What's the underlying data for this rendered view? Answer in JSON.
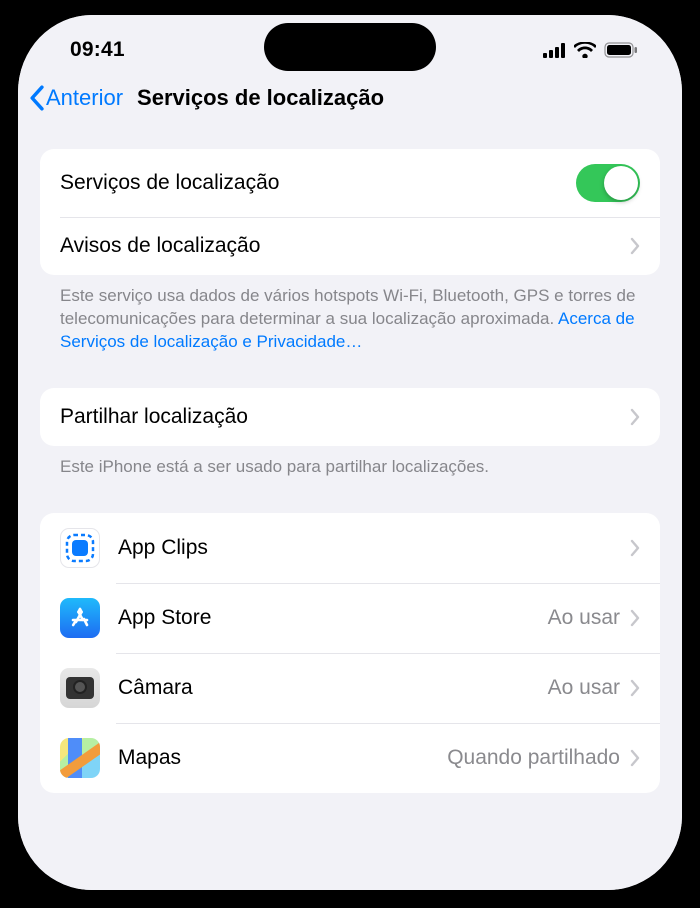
{
  "status": {
    "time": "09:41"
  },
  "nav": {
    "back_label": "Anterior",
    "title": "Serviços de localização"
  },
  "group1": {
    "location_services_label": "Serviços de localização",
    "location_services_on": true,
    "location_alerts_label": "Avisos de localização"
  },
  "footer1": {
    "text_part1": "Este serviço usa dados de vários hotspots Wi-Fi, Bluetooth, GPS e torres de telecomunicações para determinar a sua localização aproximada. ",
    "link_text": "Acerca de Serviços de localização e Privacidade…"
  },
  "group2": {
    "share_location_label": "Partilhar localização"
  },
  "footer2": {
    "text": "Este iPhone está a ser usado para partilhar localizações."
  },
  "apps": [
    {
      "name": "App Clips",
      "value": "",
      "icon": "appclips"
    },
    {
      "name": "App Store",
      "value": "Ao usar",
      "icon": "appstore"
    },
    {
      "name": "Câmara",
      "value": "Ao usar",
      "icon": "camera"
    },
    {
      "name": "Mapas",
      "value": "Quando partilhado",
      "icon": "maps"
    }
  ]
}
